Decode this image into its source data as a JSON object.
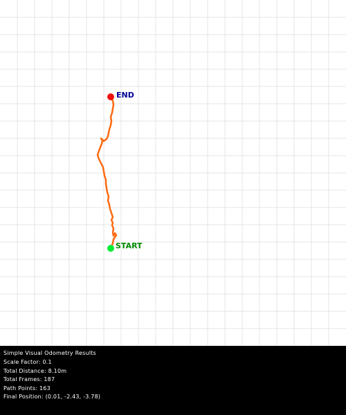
{
  "plot": {
    "start_label": "START",
    "end_label": "END",
    "start_color": "#00ee33",
    "end_color": "#ee1111",
    "start_label_color": "#008800",
    "end_label_color": "#000099",
    "path_color": "#ff6a10",
    "grid_color": "#e4e4e4",
    "background": "#ffffff"
  },
  "results": {
    "title": "Simple Visual Odometry Results",
    "scale_factor": "Scale Factor: 0.1",
    "total_distance": "Total Distance: 8.10m",
    "total_frames": "Total Frames: 187",
    "path_points": "Path Points: 163",
    "final_position": "Final Position: (0.01, -2.43, -3.78)"
  }
}
